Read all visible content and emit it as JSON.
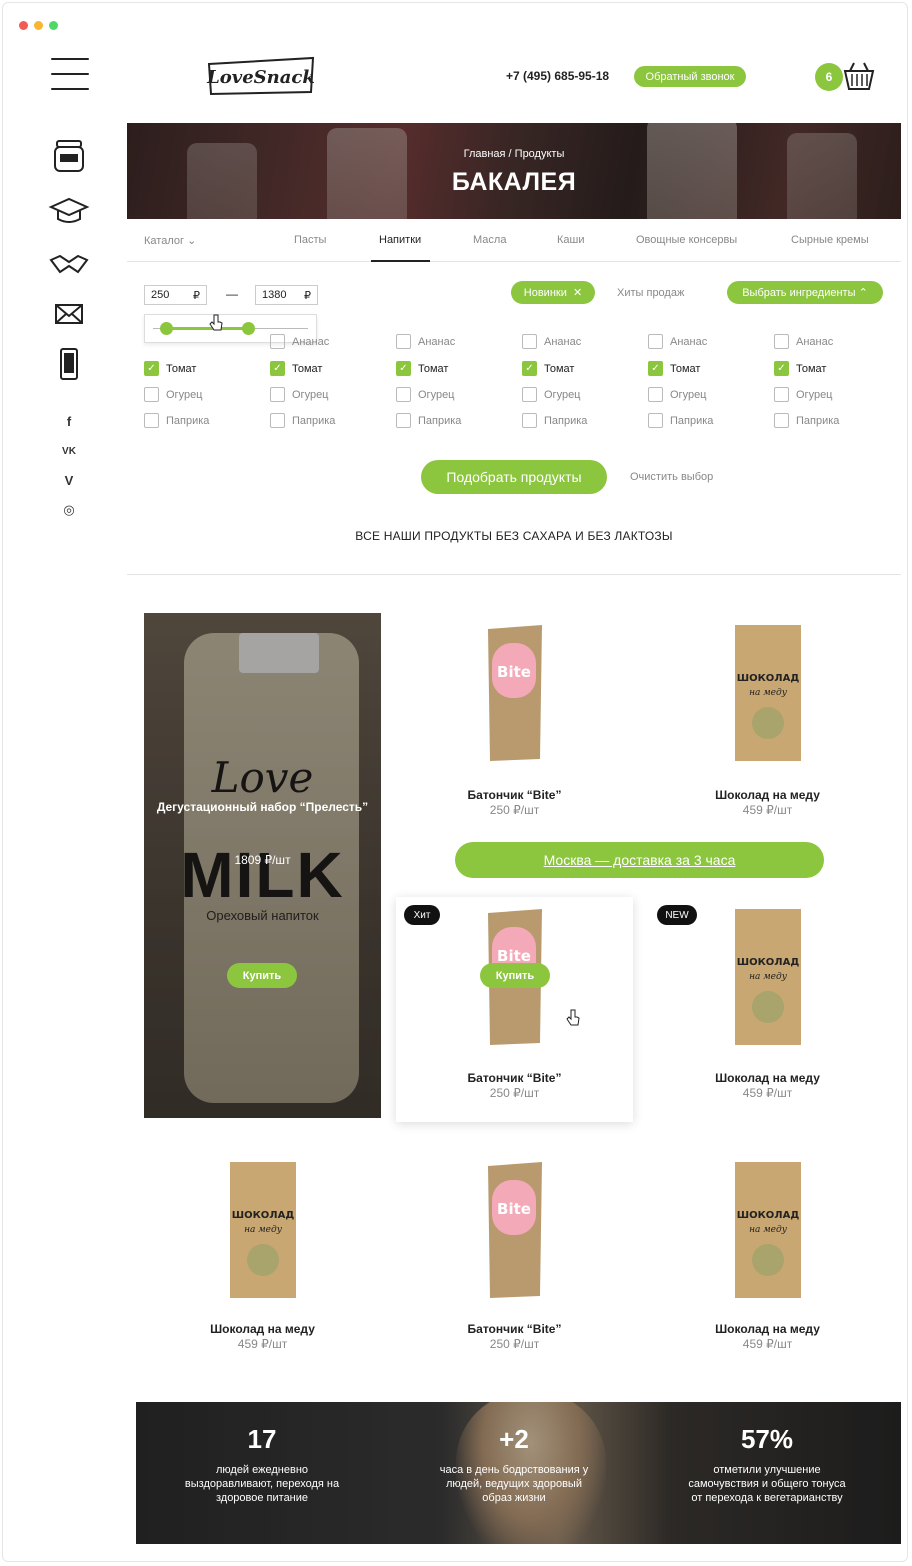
{
  "header": {
    "logo_text": "LoveSnack",
    "phone": "+7 (495) 685-95-18",
    "callback_label": "Обратный звонок",
    "cart_count": "6"
  },
  "sidebar": {
    "icons": [
      "jar-icon",
      "graduation-cap-icon",
      "handshake-icon",
      "envelope-icon",
      "phone-icon"
    ],
    "social": {
      "facebook": "f",
      "vk": "VK",
      "vimeo": "V",
      "instagram": "◎"
    }
  },
  "hero": {
    "breadcrumb": "Главная / Продукты",
    "title": "БАКАЛЕЯ"
  },
  "tabs": {
    "catalog": "Каталог",
    "items": [
      "Пасты",
      "Напитки",
      "Масла",
      "Каши",
      "Овощные консервы",
      "Сырные кремы"
    ],
    "active": "Напитки"
  },
  "filters": {
    "price_from": "250",
    "price_to": "1380",
    "currency": "₽",
    "dash": "—",
    "chip_new": "Новинки",
    "chip_close": "✕",
    "hits": "Хиты продаж",
    "ingredients_button": "Выбрать ингредиенты",
    "ingredients_chevron": "⌃",
    "checkbox_labels": [
      "Ананас",
      "Томат",
      "Огурец",
      "Паприка"
    ],
    "checked": [
      false,
      true,
      false,
      false
    ],
    "pick_button": "Подобрать продукты",
    "clear_label": "Очистить выбор"
  },
  "notice": "ВСЕ НАШИ ПРОДУКТЫ БЕЗ САХАРА И БЕЗ ЛАКТОЗЫ",
  "feature": {
    "bottle_love": "Love",
    "bottle_milk": "MILK",
    "bottle_sub": "Ореховый напиток",
    "title": "Дегустационный набор “Прелесть”",
    "price": "1809 ₽/шт",
    "buy_label": "Купить"
  },
  "products": {
    "bite_name": "Батончик “Bite”",
    "bite_price": "250 ₽/шт",
    "choco_name": "Шоколад на меду",
    "choco_price": "459 ₽/шт",
    "buy_label": "Купить",
    "badge_hit": "Хит",
    "badge_new": "NEW",
    "bite_label": "Bite",
    "choco_label": "ШОКОЛАД",
    "choco_sub": "на меду"
  },
  "delivery": "Москва — доставка за 3 часа",
  "stats": [
    {
      "num": "17",
      "text": "людей ежедневно выздоравливают, переходя на здоровое питание"
    },
    {
      "num": "+2",
      "text": "часа в день бодрствования у людей, ведущих здоровый образ жизни"
    },
    {
      "num": "57%",
      "text": "отметили улучшение самочувствия и общего тонуса от перехода к вегетарианству"
    }
  ],
  "colors": {
    "accent": "#8cc63f",
    "dark": "#111111",
    "muted": "#888888"
  }
}
